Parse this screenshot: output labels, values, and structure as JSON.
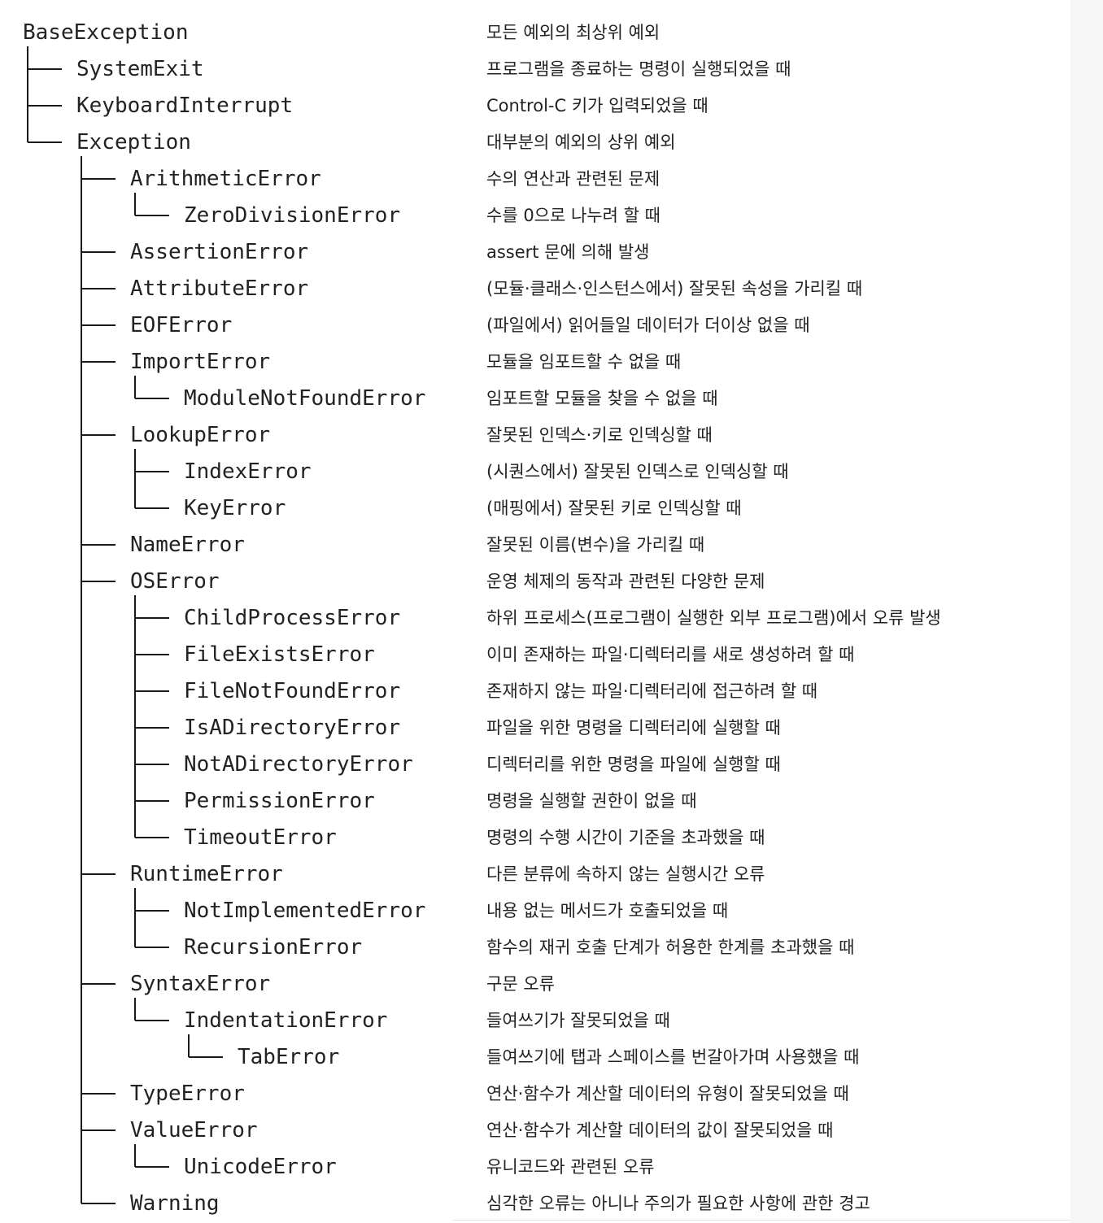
{
  "hierarchy": [
    {
      "name": "BaseException",
      "desc": "모든 예외의 최상위 예외",
      "depth": 0,
      "last": true
    },
    {
      "name": "SystemExit",
      "desc": "프로그램을 종료하는 명령이 실행되었을 때",
      "depth": 1,
      "last": false
    },
    {
      "name": "KeyboardInterrupt",
      "desc": "Control-C 키가 입력되었을 때",
      "depth": 1,
      "last": false
    },
    {
      "name": "Exception",
      "desc": "대부분의 예외의 상위 예외",
      "depth": 1,
      "last": true
    },
    {
      "name": "ArithmeticError",
      "desc": "수의 연산과 관련된 문제",
      "depth": 2,
      "last": false
    },
    {
      "name": "ZeroDivisionError",
      "desc": "수를 0으로 나누려 할 때",
      "depth": 3,
      "last": true
    },
    {
      "name": "AssertionError",
      "desc": "assert 문에 의해 발생",
      "depth": 2,
      "last": false
    },
    {
      "name": "AttributeError",
      "desc": "(모듈·클래스·인스턴스에서) 잘못된 속성을 가리킬 때",
      "depth": 2,
      "last": false
    },
    {
      "name": "EOFError",
      "desc": "(파일에서) 읽어들일 데이터가 더이상 없을 때",
      "depth": 2,
      "last": false
    },
    {
      "name": "ImportError",
      "desc": "모듈을 임포트할 수 없을 때",
      "depth": 2,
      "last": false
    },
    {
      "name": "ModuleNotFoundError",
      "desc": "임포트할 모듈을 찾을 수 없을 때",
      "depth": 3,
      "last": true
    },
    {
      "name": "LookupError",
      "desc": "잘못된 인덱스·키로 인덱싱할 때",
      "depth": 2,
      "last": false
    },
    {
      "name": "IndexError",
      "desc": "(시퀀스에서) 잘못된 인덱스로 인덱싱할 때",
      "depth": 3,
      "last": false
    },
    {
      "name": "KeyError",
      "desc": "(매핑에서) 잘못된 키로 인덱싱할 때",
      "depth": 3,
      "last": true
    },
    {
      "name": "NameError",
      "desc": "잘못된 이름(변수)을 가리킬 때",
      "depth": 2,
      "last": false
    },
    {
      "name": "OSError",
      "desc": "운영 체제의 동작과 관련된 다양한 문제",
      "depth": 2,
      "last": false
    },
    {
      "name": "ChildProcessError",
      "desc": "하위 프로세스(프로그램이 실행한 외부 프로그램)에서 오류 발생",
      "depth": 3,
      "last": false
    },
    {
      "name": "FileExistsError",
      "desc": "이미 존재하는 파일·디렉터리를 새로 생성하려 할 때",
      "depth": 3,
      "last": false
    },
    {
      "name": "FileNotFoundError",
      "desc": "존재하지 않는 파일·디렉터리에 접근하려 할 때",
      "depth": 3,
      "last": false
    },
    {
      "name": "IsADirectoryError",
      "desc": "파일을 위한 명령을 디렉터리에 실행할 때",
      "depth": 3,
      "last": false
    },
    {
      "name": "NotADirectoryError",
      "desc": "디렉터리를 위한 명령을 파일에 실행할 때",
      "depth": 3,
      "last": false
    },
    {
      "name": "PermissionError",
      "desc": "명령을 실행할 권한이 없을 때",
      "depth": 3,
      "last": false
    },
    {
      "name": "TimeoutError",
      "desc": "명령의 수행 시간이 기준을 초과했을 때",
      "depth": 3,
      "last": true
    },
    {
      "name": "RuntimeError",
      "desc": "다른 분류에 속하지 않는 실행시간 오류",
      "depth": 2,
      "last": false
    },
    {
      "name": "NotImplementedError",
      "desc": "내용 없는 메서드가 호출되었을 때",
      "depth": 3,
      "last": false
    },
    {
      "name": "RecursionError",
      "desc": "함수의 재귀 호출 단계가 허용한 한계를 초과했을 때",
      "depth": 3,
      "last": true
    },
    {
      "name": "SyntaxError",
      "desc": "구문 오류",
      "depth": 2,
      "last": false
    },
    {
      "name": "IndentationError",
      "desc": "들여쓰기가 잘못되었을 때",
      "depth": 3,
      "last": true
    },
    {
      "name": "TabError",
      "desc": "들여쓰기에 탭과 스페이스를 번갈아가며 사용했을 때",
      "depth": 4,
      "last": true
    },
    {
      "name": "TypeError",
      "desc": "연산·함수가 계산할 데이터의 유형이 잘못되었을 때",
      "depth": 2,
      "last": false
    },
    {
      "name": "ValueError",
      "desc": "연산·함수가 계산할 데이터의 값이 잘못되었을 때",
      "depth": 2,
      "last": false
    },
    {
      "name": "UnicodeError",
      "desc": "유니코드와 관련된 오류",
      "depth": 3,
      "last": true
    },
    {
      "name": "Warning",
      "desc": "심각한 오류는 아니나 주의가 필요한 사항에 관한 경고",
      "depth": 2,
      "last": true
    }
  ]
}
